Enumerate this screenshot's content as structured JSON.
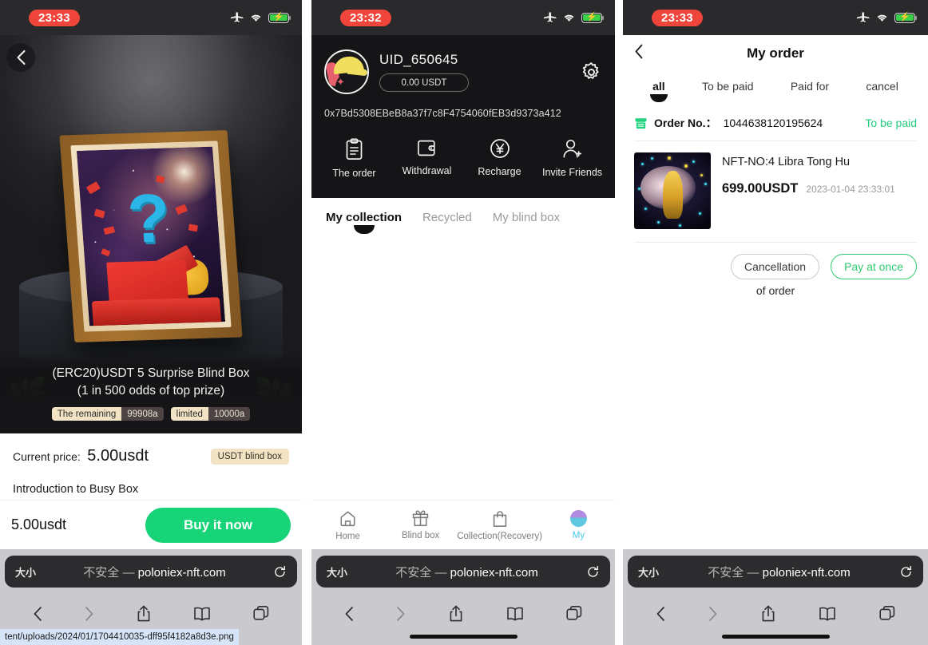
{
  "panels": {
    "detail": {
      "status": {
        "time": "23:33",
        "icons": [
          "airplane-icon",
          "wifi-icon",
          "battery-charging-icon"
        ]
      },
      "back_icon": "chevron-left-icon",
      "product": {
        "title_line1": "(ERC20)USDT 5 Surprise Blind Box",
        "title_line2": "(1 in 500 odds of top prize)",
        "badges": [
          {
            "key": "The remaining",
            "value": "99908a"
          },
          {
            "key": "limited",
            "value": "10000a"
          }
        ],
        "price_label": "Current price:",
        "price_value": "5.00usdt",
        "type_tag": "USDT blind box",
        "intro_title": "Introduction to Busy Box"
      },
      "buybar": {
        "price": "5.00usdt",
        "buy_label": "Buy it now"
      },
      "url_tooltip": "tent/uploads/2024/01/1704410035-dff95f4182a8d3e.png"
    },
    "profile": {
      "status": {
        "time": "23:32"
      },
      "uid": "UID_650645",
      "balance": "0.00 USDT",
      "wallet": "0x7Bd5308EBeB8a37f7c8F4754060fEB3d9373a412",
      "settings_icon": "gear-icon",
      "actions": [
        {
          "icon": "clipboard-icon",
          "label": "The order"
        },
        {
          "icon": "wallet-icon",
          "label": "Withdrawal"
        },
        {
          "icon": "yen-circle-icon",
          "label": "Recharge"
        },
        {
          "icon": "person-add-icon",
          "label": "Invite Friends"
        }
      ],
      "tabs": [
        {
          "label": "My collection",
          "active": true
        },
        {
          "label": "Recycled",
          "active": false
        },
        {
          "label": "My blind box",
          "active": false
        }
      ],
      "bottom_nav": [
        {
          "icon": "home-icon",
          "label": "Home",
          "active": false
        },
        {
          "icon": "gift-icon",
          "label": "Blind box",
          "active": false
        },
        {
          "icon": "bag-icon",
          "label": "Collection(Recovery)",
          "active": false
        },
        {
          "icon": "avatar-icon",
          "label": "My",
          "active": true
        }
      ]
    },
    "order": {
      "status": {
        "time": "23:33"
      },
      "title": "My order",
      "back_icon": "chevron-left-icon",
      "tabs": [
        {
          "label": "all",
          "active": true
        },
        {
          "label": "To be paid",
          "active": false
        },
        {
          "label": "Paid for",
          "active": false
        },
        {
          "label": "cancel",
          "active": false
        }
      ],
      "card": {
        "shop_icon": "shop-icon",
        "order_no_label": "Order No.：",
        "order_no": "1044638120195624",
        "status": "To be paid",
        "item_name": "NFT-NO:4 Libra Tong Hu",
        "item_price": "699.00USDT",
        "item_time": "2023-01-04 23:33:01",
        "buttons": [
          {
            "label": "Cancellation",
            "style": "ghost"
          },
          {
            "label": "Pay at once",
            "style": "primary"
          }
        ],
        "sub_label": "of order"
      }
    }
  },
  "browser": {
    "size_label": "大小",
    "insecure_label": "不安全 —",
    "domain": "poloniex-nft.com",
    "reload_icon": "reload-icon",
    "toolbar": [
      {
        "icon": "back-icon"
      },
      {
        "icon": "forward-icon"
      },
      {
        "icon": "share-icon"
      },
      {
        "icon": "bookmarks-icon"
      },
      {
        "icon": "tabs-icon"
      }
    ]
  },
  "colors": {
    "accent_green": "#16d477",
    "status_green": "#22cd7e",
    "tag_cream": "#f2e3c4",
    "time_red": "#f0453a",
    "active_cyan": "#46c8e6"
  }
}
